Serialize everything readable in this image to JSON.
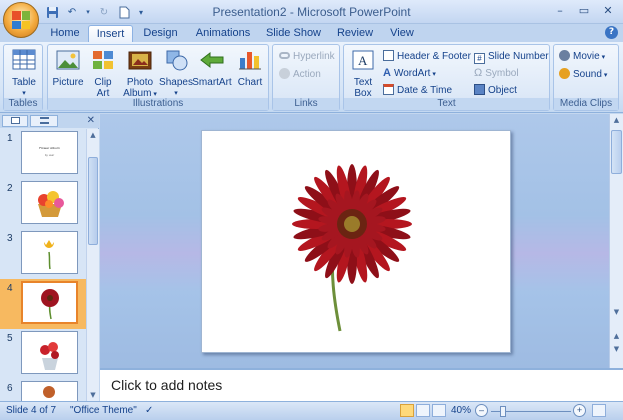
{
  "window": {
    "title": "Presentation2 - Microsoft PowerPoint",
    "minimize": "–",
    "restore": "▭",
    "close": "✕"
  },
  "tabs": [
    {
      "label": "Home",
      "active": false
    },
    {
      "label": "Insert",
      "active": true
    },
    {
      "label": "Design",
      "active": false
    },
    {
      "label": "Animations",
      "active": false
    },
    {
      "label": "Slide Show",
      "active": false
    },
    {
      "label": "Review",
      "active": false
    },
    {
      "label": "View",
      "active": false
    }
  ],
  "help": "?",
  "ribbon": {
    "tables": {
      "label": "Tables",
      "table": "Table"
    },
    "illustrations": {
      "label": "Illustrations",
      "picture": "Picture",
      "clip_art_1": "Clip",
      "clip_art_2": "Art",
      "photo_album_1": "Photo",
      "photo_album_2": "Album",
      "shapes": "Shapes",
      "smartart": "SmartArt",
      "chart": "Chart"
    },
    "links": {
      "label": "Links",
      "hyperlink": "Hyperlink",
      "action": "Action"
    },
    "text": {
      "label": "Text",
      "text_box_1": "Text",
      "text_box_2": "Box",
      "header_footer": "Header & Footer",
      "wordart": "WordArt",
      "date_time": "Date & Time",
      "slide_number": "Slide Number",
      "symbol": "Symbol",
      "object": "Object"
    },
    "media": {
      "label": "Media Clips",
      "movie": "Movie",
      "sound": "Sound"
    }
  },
  "slides": [
    {
      "number": "1",
      "selected": false,
      "image": "title-slide"
    },
    {
      "number": "2",
      "selected": false,
      "image": "flower-basket"
    },
    {
      "number": "3",
      "selected": false,
      "image": "tulip"
    },
    {
      "number": "4",
      "selected": true,
      "image": "gerbera"
    },
    {
      "number": "5",
      "selected": false,
      "image": "roses"
    },
    {
      "number": "6",
      "selected": false,
      "image": "partial"
    }
  ],
  "thumb1": {
    "title": "Flower Album",
    "subtitle": "by user"
  },
  "notes": {
    "placeholder": "Click to add notes"
  },
  "status": {
    "slide_info": "Slide 4 of 7",
    "theme": "\"Office Theme\"",
    "zoom": "40%"
  },
  "colors": {
    "accent": "#15428b",
    "selected_thumb": "#f7b960",
    "flower": "#b4161f"
  }
}
